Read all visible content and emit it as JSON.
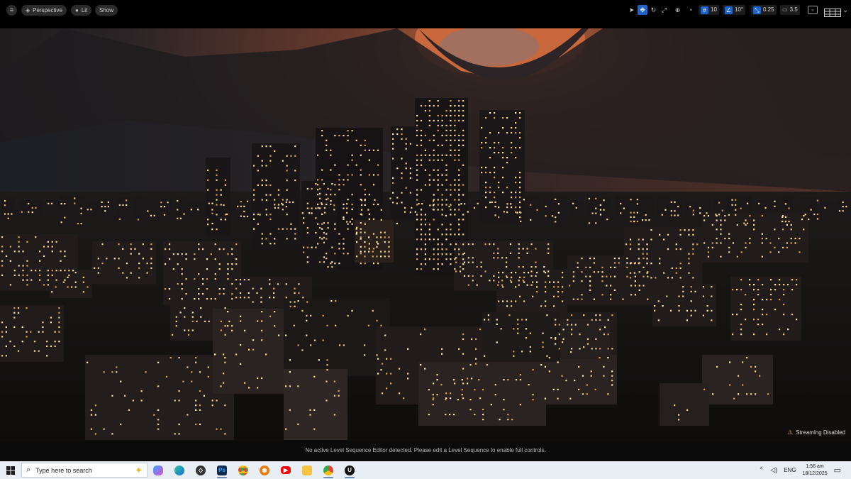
{
  "toolbar": {
    "menu_icon": "hamburger-icon",
    "perspective_label": "Perspective",
    "lit_label": "Lit",
    "show_label": "Show",
    "grid_snap_value": "10",
    "rotation_snap_value": "10°",
    "scale_snap_value": "0.25",
    "camera_speed_value": "3.5"
  },
  "viewport": {
    "streaming_label": "Streaming Disabled"
  },
  "status": {
    "message": "No active Level Sequence Editor detected. Please edit a Level Sequence to enable full controls."
  },
  "taskbar": {
    "search_placeholder": "Type here to search",
    "tray_language": "ENG",
    "clock_time": "1:56 am",
    "clock_date": "18/12/2025",
    "apps": [
      "copilot",
      "edge",
      "unity",
      "photoshop",
      "chrome",
      "blender",
      "youtube",
      "file-explorer",
      "chrome-profile",
      "unreal-engine"
    ]
  },
  "colors": {
    "toolbar_bg": "#000000",
    "accent_blue": "#1f62c9",
    "taskbar_bg": "#e9eef4",
    "sky_glow": "#b0502a"
  }
}
